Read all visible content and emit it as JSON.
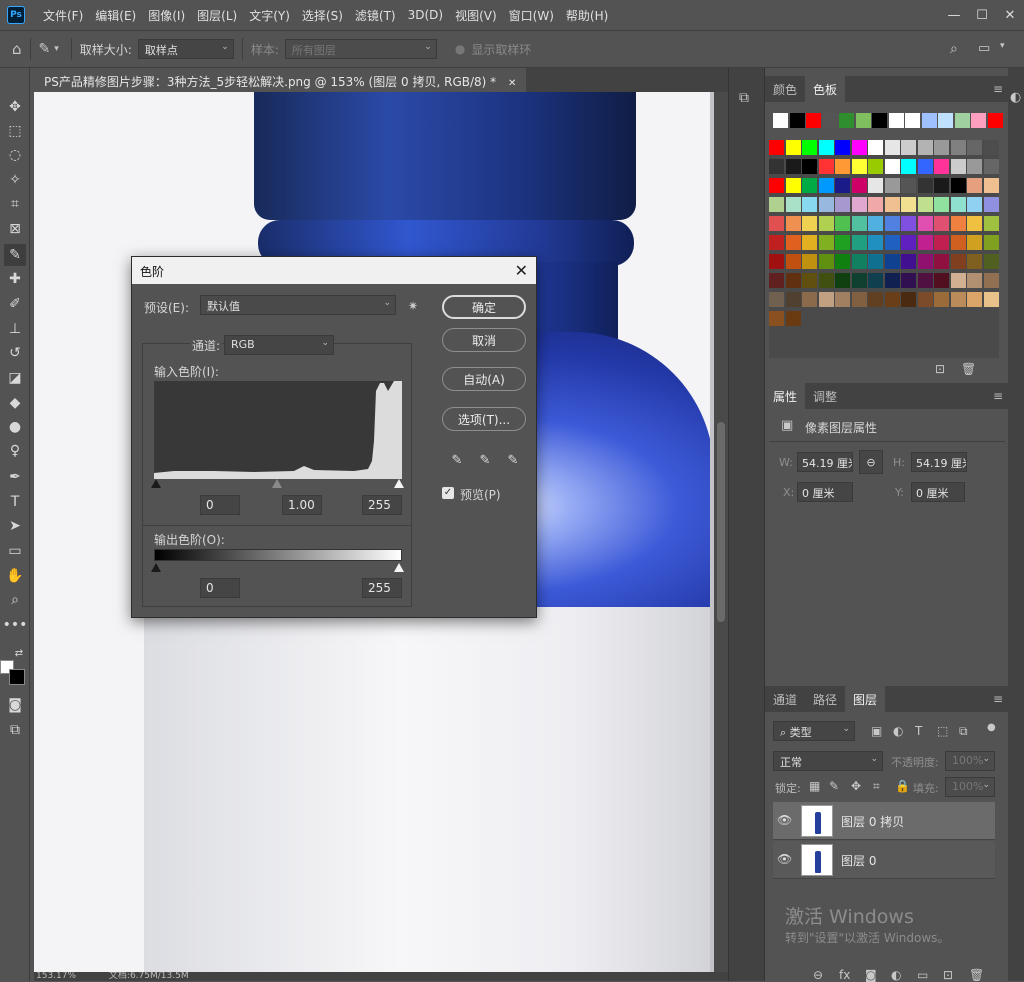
{
  "app": {
    "logo_text": "Ps"
  },
  "menubar": {
    "items": [
      "文件(F)",
      "编辑(E)",
      "图像(I)",
      "图层(L)",
      "文字(Y)",
      "选择(S)",
      "滤镜(T)",
      "3D(D)",
      "视图(V)",
      "窗口(W)",
      "帮助(H)"
    ],
    "window_controls": {
      "minimize": "—",
      "maximize": "☐",
      "close": "✕"
    }
  },
  "options_bar": {
    "sample_size_label": "取样大小:",
    "sample_size_value": "取样点",
    "sample_label": "样本:",
    "sample_value": "所有图层",
    "show_ring_label": "显示取样环"
  },
  "document": {
    "tab_title": "PS产品精修图片步骤：3种方法_5步轻松解决.png @ 153% (图层 0 拷贝, RGB/8) *",
    "tab_close": "✕",
    "zoom": "153.17%",
    "doc_size": "文档:6.75M/13.5M"
  },
  "levels_dialog": {
    "title": "色阶",
    "close": "✕",
    "preset_label": "预设(E):",
    "preset_value": "默认值",
    "channel_label": "通道:",
    "channel_value": "RGB",
    "input_levels_label": "输入色阶(I):",
    "input_black": "0",
    "input_gamma": "1.00",
    "input_white": "255",
    "output_levels_label": "输出色阶(O):",
    "output_black": "0",
    "output_white": "255",
    "buttons": {
      "ok": "确定",
      "cancel": "取消",
      "auto": "自动(A)",
      "options": "选项(T)..."
    },
    "preview_label": "预览(P)",
    "preview_checked": true
  },
  "swatches_panel": {
    "tabs": [
      "颜色",
      "色板"
    ],
    "active_tab": "色板",
    "recent": [
      "#ffffff",
      "#000000",
      "#ff0000",
      "#555555",
      "#2f8f2f",
      "#7fbf5f",
      "#000000",
      "#ffffff",
      "#ffffff",
      "#9fc0ff",
      "#bfe0ff",
      "#a0d0a0",
      "#ff9fbf",
      "#ff0000"
    ],
    "grid": [
      [
        "#ff0000",
        "#ffff00",
        "#00ff00",
        "#00ffff",
        "#0000ff",
        "#ff00ff",
        "#ffffff",
        "#e6e6e6",
        "#cccccc",
        "#b3b3b3",
        "#999999",
        "#808080",
        "#666666",
        "#4d4d4d"
      ],
      [
        "#333333",
        "#1a1a1a",
        "#000000",
        "#ff3333",
        "#ff9933",
        "#ffff33",
        "#99cc00",
        "#ffffff",
        "#00ffff",
        "#3366ff",
        "#ff3399",
        "#cccccc",
        "#999999",
        "#666666"
      ],
      [
        "#ff0000",
        "#ffff00",
        "#00aa44",
        "#0099ff",
        "#1a1a88",
        "#cc0066",
        "#e6e6e6",
        "#999999",
        "#555555",
        "#333333",
        "#1a1a1a",
        "#000000",
        "#e6a080",
        "#f0c090"
      ],
      [
        "#b0d090",
        "#a8e0c8",
        "#88d8f0",
        "#98b8e0",
        "#a898d0",
        "#e0a8d0",
        "#f0a8a8",
        "#f0c090",
        "#f0e090",
        "#c0e090",
        "#90e0a0",
        "#90e0d0",
        "#90d0f0",
        "#9090e0"
      ],
      [
        "#e05050",
        "#f09050",
        "#f0d050",
        "#b0d050",
        "#50c050",
        "#50c0a0",
        "#50b0e0",
        "#5080e0",
        "#8050e0",
        "#e050b0",
        "#e05070",
        "#f08040",
        "#f0c040",
        "#a0c040"
      ],
      [
        "#c02020",
        "#e06020",
        "#e0b020",
        "#80b020",
        "#20a020",
        "#20a080",
        "#2090c0",
        "#2060c0",
        "#6020c0",
        "#c02090",
        "#c02050",
        "#d06020",
        "#d0a020",
        "#80a020"
      ],
      [
        "#a01010",
        "#c05010",
        "#c09010",
        "#609010",
        "#108010",
        "#108060",
        "#107090",
        "#104090",
        "#401090",
        "#901070",
        "#901040",
        "#804020",
        "#806020",
        "#506020"
      ],
      [
        "#602020",
        "#603010",
        "#605010",
        "#405010",
        "#104010",
        "#104030",
        "#104050",
        "#102050",
        "#301050",
        "#501040",
        "#501020",
        "#d0b090",
        "#b09070",
        "#907050"
      ],
      [
        "#706050",
        "#504030",
        "#8a6a4a",
        "#c0a080",
        "#a08060",
        "#806040",
        "#604020",
        "#6b3e1a",
        "#4a2a10",
        "#7b4b2a",
        "#9b6b3a",
        "#bb8b5a",
        "#dba56a",
        "#e8c08a"
      ],
      [
        "#8a5020",
        "#6a3a10"
      ]
    ]
  },
  "properties_panel": {
    "tabs": [
      "属性",
      "调整"
    ],
    "active_tab": "属性",
    "heading": "像素图层属性",
    "w_label": "W:",
    "w_value": "54.19 厘米",
    "h_label": "H:",
    "h_value": "54.19 厘米",
    "x_label": "X:",
    "x_value": "0 厘米",
    "y_label": "Y:",
    "y_value": "0 厘米",
    "link_icon": "⊖"
  },
  "layers_panel": {
    "tabs": [
      "通道",
      "路径",
      "图层"
    ],
    "active_tab": "图层",
    "filter_kind": "类型",
    "blend_mode": "正常",
    "opacity_label": "不透明度:",
    "opacity_value": "100%",
    "lock_label": "锁定:",
    "fill_label": "填充:",
    "fill_value": "100%",
    "layers": [
      {
        "name": "图层 0 拷贝",
        "visible": true,
        "active": true
      },
      {
        "name": "图层 0",
        "visible": true,
        "active": false
      }
    ]
  },
  "watermark": {
    "title": "激活 Windows",
    "subtitle": "转到\"设置\"以激活 Windows。"
  }
}
